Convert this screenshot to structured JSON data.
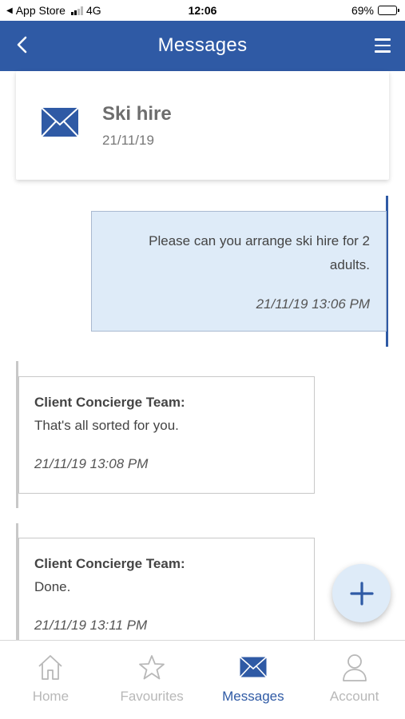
{
  "status_bar": {
    "carrier": "App Store",
    "network": "4G",
    "time": "12:06",
    "battery": "69%",
    "battery_level": 0.69
  },
  "nav": {
    "title": "Messages",
    "back_icon": "chevron-left-icon",
    "menu_icon": "hamburger-menu-icon"
  },
  "thread": {
    "icon": "envelope-icon",
    "title": "Ski hire",
    "date": "21/11/19"
  },
  "messages": [
    {
      "direction": "sent",
      "text": "Please can you arrange ski hire for 2 adults.",
      "time": "21/11/19 13:06 PM"
    },
    {
      "direction": "received",
      "sender": "Client Concierge Team:",
      "text": "That's all sorted for you.",
      "time": "21/11/19 13:08 PM"
    },
    {
      "direction": "received",
      "sender": "Client Concierge Team:",
      "text": "Done.",
      "time": "21/11/19 13:11 PM"
    }
  ],
  "fab": {
    "icon": "plus-icon"
  },
  "tab_bar": {
    "tabs": [
      {
        "label": "Home",
        "icon": "home-icon",
        "active": false
      },
      {
        "label": "Favourites",
        "icon": "star-icon",
        "active": false
      },
      {
        "label": "Messages",
        "icon": "envelope-icon",
        "active": true
      },
      {
        "label": "Account",
        "icon": "person-icon",
        "active": false
      }
    ]
  },
  "colors": {
    "brand_blue": "#2f5aa5",
    "sent_bubble": "#deebf8",
    "inactive_tab": "#b8b8b8"
  }
}
